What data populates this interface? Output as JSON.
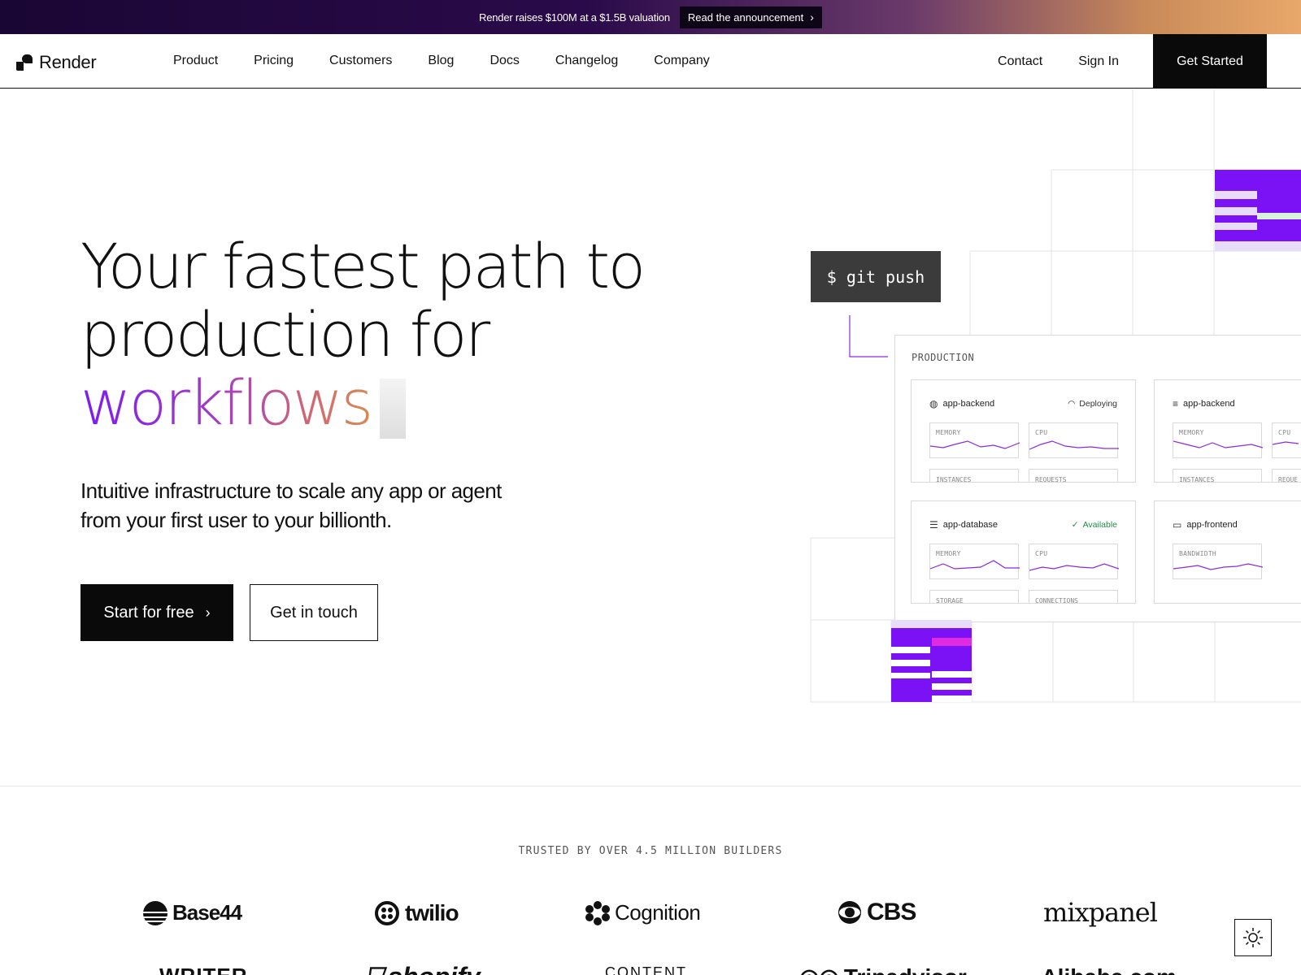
{
  "announcement": {
    "text": "Render raises $100M at a $1.5B valuation",
    "link_label": "Read the announcement"
  },
  "nav": {
    "brand": "Render",
    "links": [
      "Product",
      "Pricing",
      "Customers",
      "Blog",
      "Docs",
      "Changelog",
      "Company"
    ],
    "contact": "Contact",
    "sign_in": "Sign In",
    "cta": "Get Started"
  },
  "hero": {
    "title_line1": "Your fastest path to",
    "title_line2": "production for",
    "title_highlight": "workflows",
    "subtitle_line1": "Intuitive infrastructure to scale any app or agent",
    "subtitle_line2": "from your first user to your billionth.",
    "primary_cta": "Start for free",
    "secondary_cta": "Get in touch"
  },
  "illustration": {
    "command": "$ git push",
    "environment": "PRODUCTION",
    "services": [
      {
        "name": "app-backend",
        "icon": "globe-icon",
        "status": "Deploying",
        "metrics": [
          "MEMORY",
          "CPU",
          "INSTANCES",
          "REQUESTS"
        ]
      },
      {
        "name": "app-backend",
        "icon": "list-icon",
        "status": "",
        "metrics": [
          "MEMORY",
          "CPU",
          "INSTANCES",
          "REQUE"
        ]
      },
      {
        "name": "app-database",
        "icon": "database-icon",
        "status": "Available",
        "metrics": [
          "MEMORY",
          "CPU",
          "STORAGE",
          "CONNECTIONS"
        ]
      },
      {
        "name": "app-frontend",
        "icon": "monitor-icon",
        "status": "",
        "metrics": [
          "BANDWIDTH"
        ]
      }
    ]
  },
  "trusted": {
    "heading": "TRUSTED BY OVER 4.5 MILLION BUILDERS",
    "logos": [
      "Base44",
      "twilio",
      "Cognition",
      "CBS",
      "mixpanel",
      "WRITER",
      "shopify",
      "CONTENT",
      "Tripadvisor",
      "Alibaba.com"
    ]
  },
  "colors": {
    "accent_purple": "#7b12f5",
    "purple_light": "#e8dcfb",
    "pink": "#e12be0",
    "mint": "#d9f2dc",
    "available_green": "#1f8a4c"
  }
}
